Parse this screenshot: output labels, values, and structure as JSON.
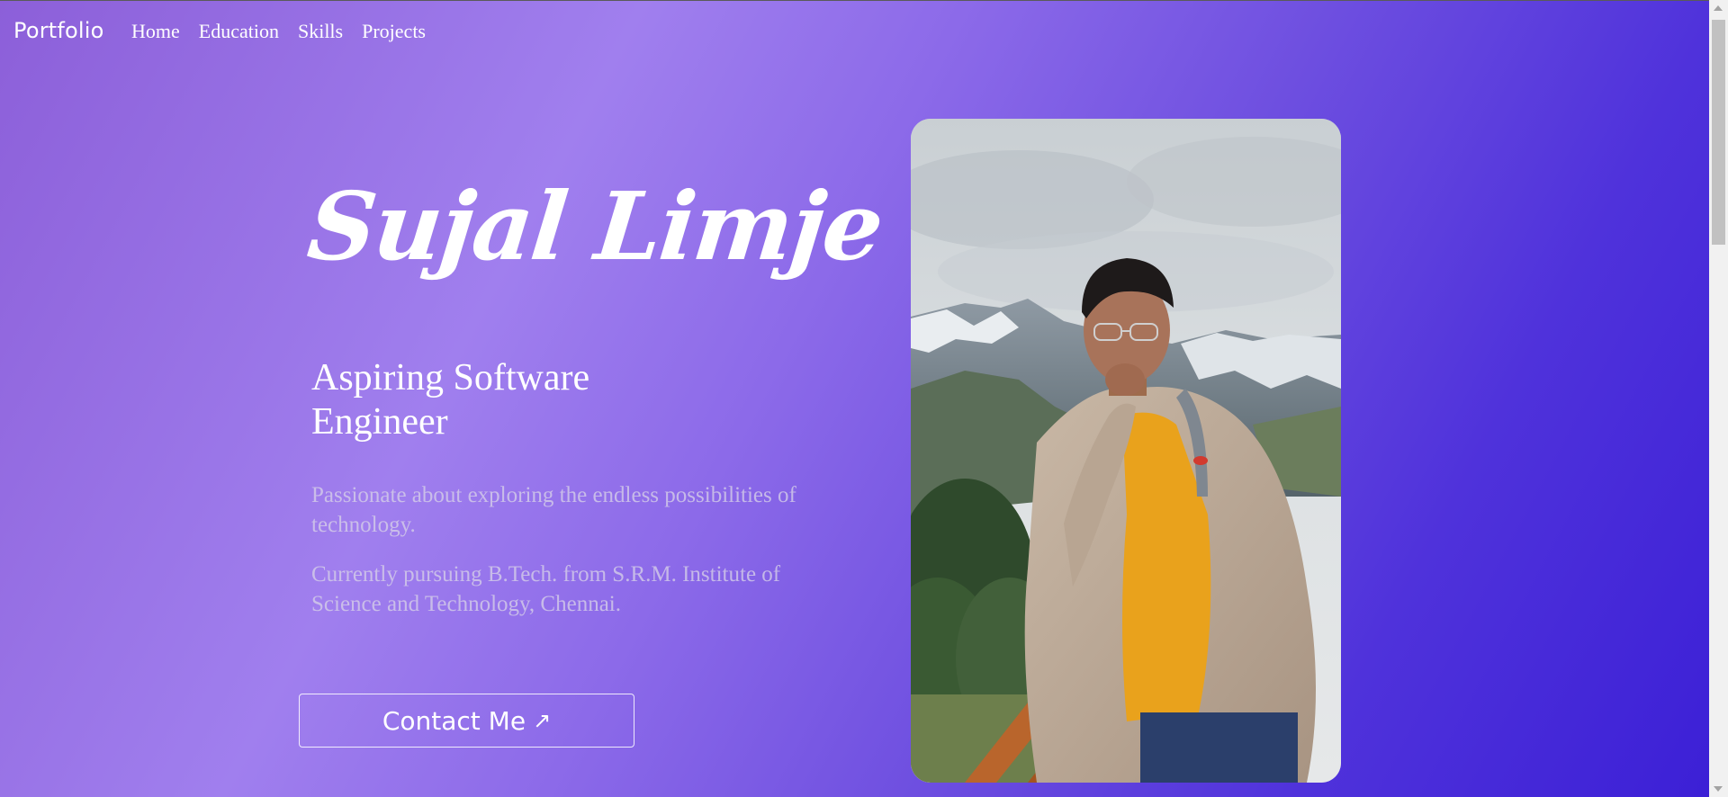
{
  "navbar": {
    "brand": "Portfolio",
    "links": [
      "Home",
      "Education",
      "Skills",
      "Projects"
    ]
  },
  "hero": {
    "name": "Sujal Limje",
    "subtitle": "Aspiring Software Engineer",
    "paragraphs": [
      "Passionate about exploring the endless possibilities of technology.",
      "Currently pursuing B.Tech. from S.R.M. Institute of Science and Technology, Chennai."
    ],
    "contact_label": "Contact Me",
    "contact_icon": "arrow-up-right-icon"
  },
  "colors": {
    "gradient_start": "#8c5fd9",
    "gradient_light": "#a07fee",
    "gradient_end": "#3b1fd6",
    "text": "#ffffff",
    "muted_text": "#d6d0e8"
  }
}
